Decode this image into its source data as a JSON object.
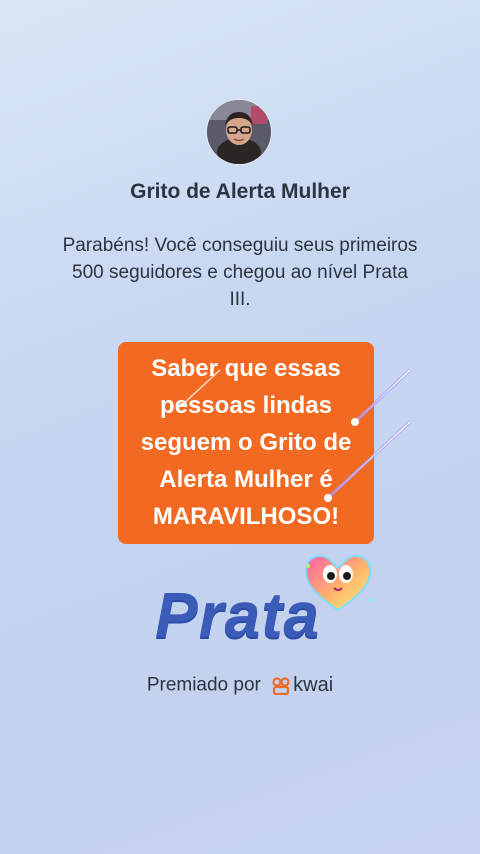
{
  "profile": {
    "name": "Grito de Alerta Mulher"
  },
  "message": "Parabéns! Você conseguiu seus primeiros 500 seguidores e chegou ao nível Prata III.",
  "caption": "Saber que essas pessoas lindas seguem o Grito de Alerta Mulher é MARAVILHOSO!",
  "level": {
    "title": "Prata"
  },
  "footer": {
    "label": "Premiado por",
    "brand": "kwai"
  },
  "colors": {
    "caption_bg": "#f26a21",
    "level_text": "#3b5bb8",
    "brand_icon": "#f26a21"
  },
  "icons": {
    "avatar": "profile-photo",
    "mascot": "heart-mascot-icon",
    "brand": "kwai-logo-icon"
  }
}
